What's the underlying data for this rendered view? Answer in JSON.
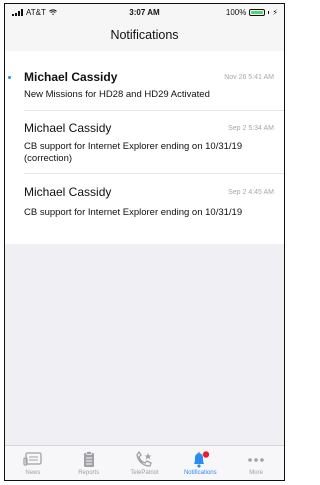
{
  "status_bar": {
    "carrier": "AT&T",
    "time": "3:07 AM",
    "battery": "100%"
  },
  "header": {
    "title": "Notifications"
  },
  "notifications": [
    {
      "sender": "Michael Cassidy",
      "time": "Nov 26 5:41 AM",
      "message": "New Missions for HD28 and HD29 Activated",
      "unread": true
    },
    {
      "sender": "Michael Cassidy",
      "time": "Sep 2 5:34 AM",
      "message": "CB support for Internet Explorer ending on 10/31/19 (correction)",
      "unread": false
    },
    {
      "sender": "Michael Cassidy",
      "time": "Sep 2 4:45 AM",
      "message": "CB support for Internet Explorer ending on 10/31/19",
      "unread": false
    }
  ],
  "tabbar": {
    "tabs": [
      {
        "label": "News",
        "icon": "news-icon",
        "active": false
      },
      {
        "label": "Reports",
        "icon": "reports-icon",
        "active": false
      },
      {
        "label": "TelePatriot",
        "icon": "telepatriot-icon",
        "active": false
      },
      {
        "label": "Notifications",
        "icon": "bell-icon",
        "active": true
      },
      {
        "label": "More",
        "icon": "more-icon",
        "active": false
      }
    ]
  },
  "colors": {
    "accent": "#2a8bf2",
    "badge": "#e8202a",
    "battery": "#4cd964",
    "inactive": "#a0a0a6"
  }
}
